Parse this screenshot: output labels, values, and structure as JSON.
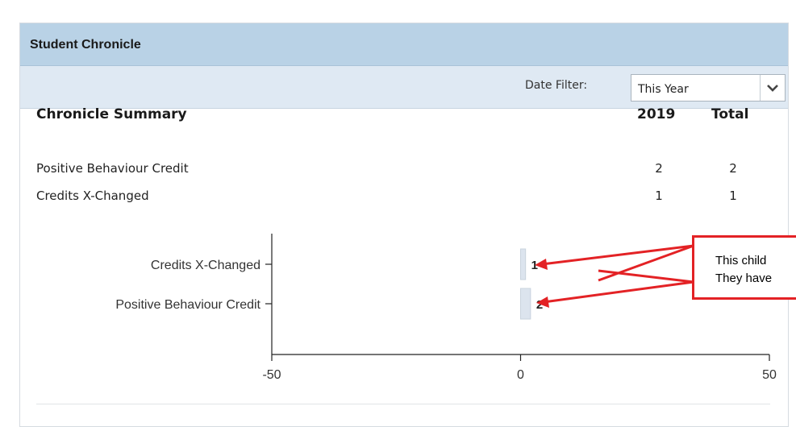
{
  "panel": {
    "title": "Student Chronicle"
  },
  "filter": {
    "label": "Date Filter:",
    "selected": "This Year"
  },
  "summary": {
    "heading": "Chronicle Summary",
    "col_year": "2019",
    "col_total": "Total",
    "rows": [
      {
        "label": "Positive Behaviour Credit",
        "year": "2",
        "total": "2"
      },
      {
        "label": "Credits X-Changed",
        "year": "1",
        "total": "1"
      }
    ]
  },
  "chart_data": {
    "type": "bar",
    "orientation": "horizontal",
    "categories": [
      "Credits X-Changed",
      "Positive Behaviour Credit"
    ],
    "values": [
      1,
      2
    ],
    "data_labels": [
      "1",
      "2"
    ],
    "xlim": [
      -50,
      50
    ],
    "xticks": [
      "-50",
      "0",
      "50"
    ],
    "grid": false,
    "bar_color": "#dce4ee"
  },
  "callout": {
    "lines": [
      "This child",
      "They have"
    ]
  },
  "colors": {
    "header": "#b9d2e6",
    "filter_bar": "#dfe9f3",
    "annotation": "#e32225"
  }
}
